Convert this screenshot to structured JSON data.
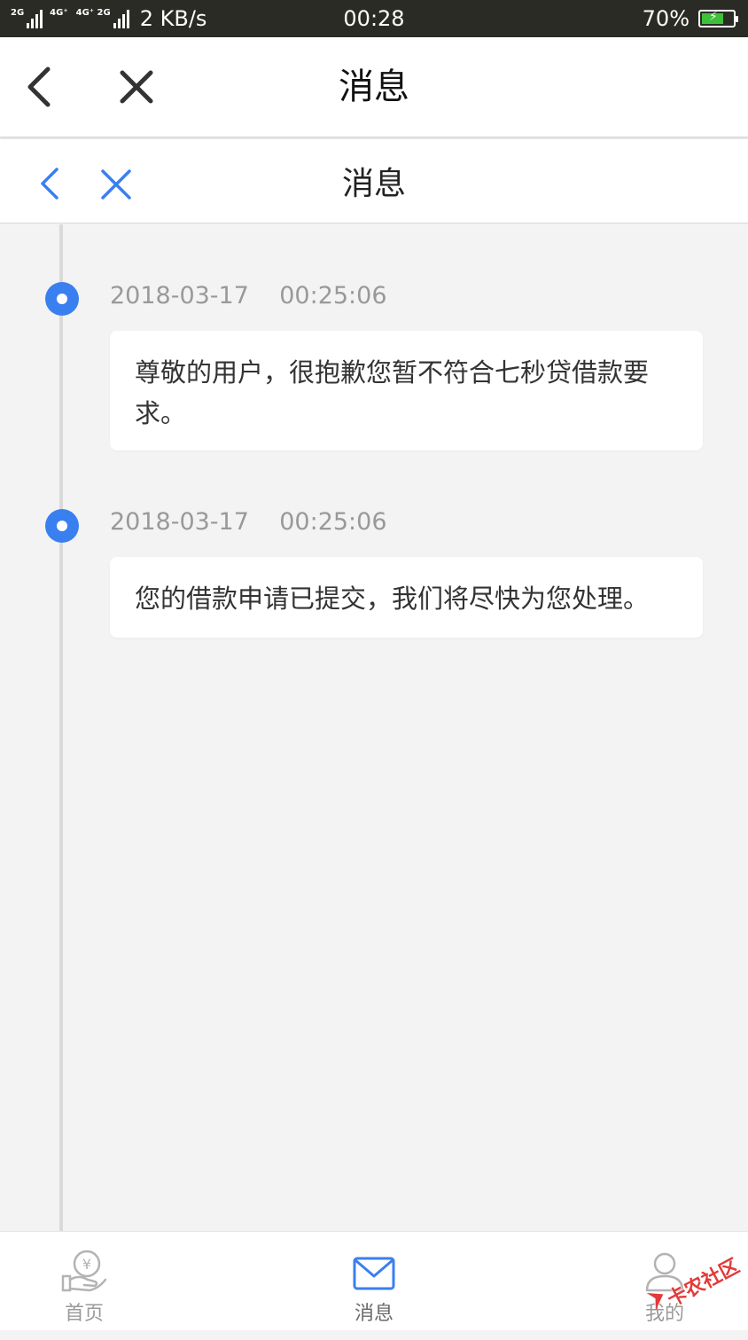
{
  "status_bar": {
    "sim1_label": "2G",
    "sim2_label": "4G⁺",
    "sim3_label": "4G⁺ 2G",
    "net_speed": "2 KB/s",
    "time": "00:28",
    "battery_percent": "70%",
    "battery_level": 0.7,
    "charging": true
  },
  "outer_header": {
    "title": "消息"
  },
  "inner_header": {
    "title": "消息"
  },
  "timeline": {
    "accent_color": "#3a7ff0",
    "entries": [
      {
        "timestamp": "2018-03-17    00:25:06",
        "message": "尊敬的用户，很抱歉您暂不符合七秒贷借款要求。"
      },
      {
        "timestamp": "2018-03-17    00:25:06",
        "message": "您的借款申请已提交，我们将尽快为您处理。"
      }
    ]
  },
  "tabbar": {
    "tabs": [
      {
        "label": "首页",
        "icon": "coin-hand-icon",
        "active": false
      },
      {
        "label": "消息",
        "icon": "envelope-icon",
        "active": true
      },
      {
        "label": "我的",
        "icon": "user-icon",
        "active": false
      }
    ]
  },
  "watermark": {
    "text": "卡农社区"
  }
}
